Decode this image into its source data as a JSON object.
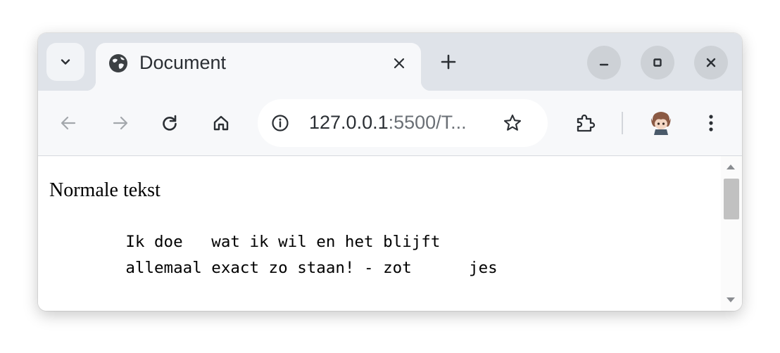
{
  "tab": {
    "title": "Document",
    "favicon": "globe-icon"
  },
  "window_controls": [
    "minimize-icon",
    "maximize-icon",
    "close-icon"
  ],
  "toolbar": {
    "url_host": "127.0.0.1",
    "url_rest": ":5500/T...",
    "icons": [
      "back-arrow-icon",
      "forward-arrow-icon",
      "reload-icon",
      "home-icon",
      "info-icon",
      "star-icon",
      "extensions-icon",
      "profile-avatar",
      "more-menu-icon"
    ]
  },
  "page": {
    "normal_text": "Normale tekst",
    "pre_text": "        Ik doe   wat ik wil en het blijft\n        allemaal exact zo staan! - zot      jes"
  },
  "colors": {
    "tabstrip": "#dfe3e9",
    "toolbar": "#f7f8fa",
    "window_button": "#cdd1d6"
  }
}
